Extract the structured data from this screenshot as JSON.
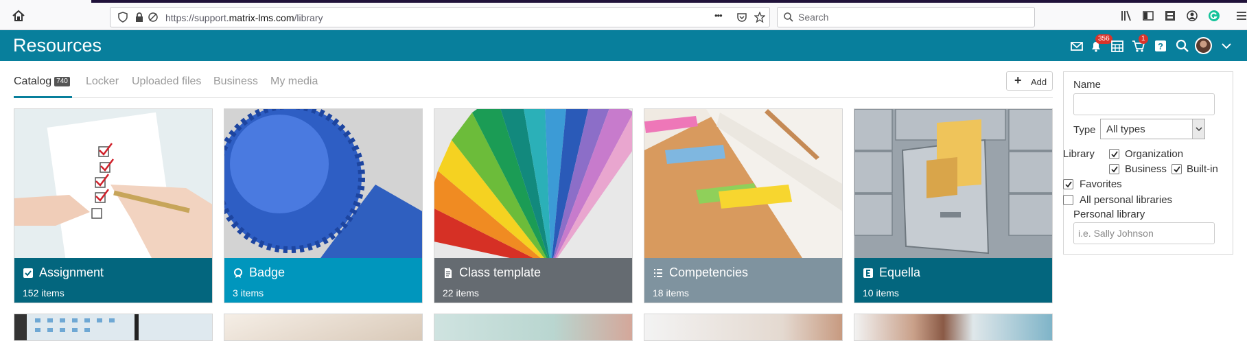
{
  "browser": {
    "url_prefix": "https://support.",
    "url_domain": "matrix-lms.com",
    "url_path": "/library",
    "search_placeholder": "Search",
    "menu_dots": "•••"
  },
  "header": {
    "title": "Resources",
    "notifications_count": "356",
    "cart_count": "1",
    "brand_color": "#087f9c"
  },
  "tabs": {
    "items": [
      {
        "label": "Catalog",
        "badge": "740",
        "active": true
      },
      {
        "label": "Locker"
      },
      {
        "label": "Uploaded files"
      },
      {
        "label": "Business"
      },
      {
        "label": "My media"
      }
    ],
    "add_label": "Add"
  },
  "cards": [
    {
      "title": "Assignment",
      "count": "152 items",
      "icon": "checkbox-icon",
      "color": "#03667e"
    },
    {
      "title": "Badge",
      "count": "3 items",
      "icon": "badge-icon",
      "color": "#0096bd"
    },
    {
      "title": "Class template",
      "count": "22 items",
      "icon": "document-icon",
      "color": "#656b71"
    },
    {
      "title": "Competencies",
      "count": "18 items",
      "icon": "list-icon",
      "color": "#7f939f"
    },
    {
      "title": "Equella",
      "count": "10 items",
      "icon": "equella-icon",
      "color": "#03667e"
    }
  ],
  "filters": {
    "name_label": "Name",
    "name_value": "",
    "type_label": "Type",
    "type_value": "All types",
    "library_label": "Library",
    "organization_label": "Organization",
    "business_label": "Business",
    "builtin_label": "Built-in",
    "favorites_label": "Favorites",
    "all_personal_label": "All personal libraries",
    "personal_label": "Personal library",
    "personal_placeholder": "i.e. Sally Johnson",
    "organization_checked": true,
    "business_checked": true,
    "builtin_checked": true,
    "favorites_checked": true,
    "all_personal_checked": false
  }
}
